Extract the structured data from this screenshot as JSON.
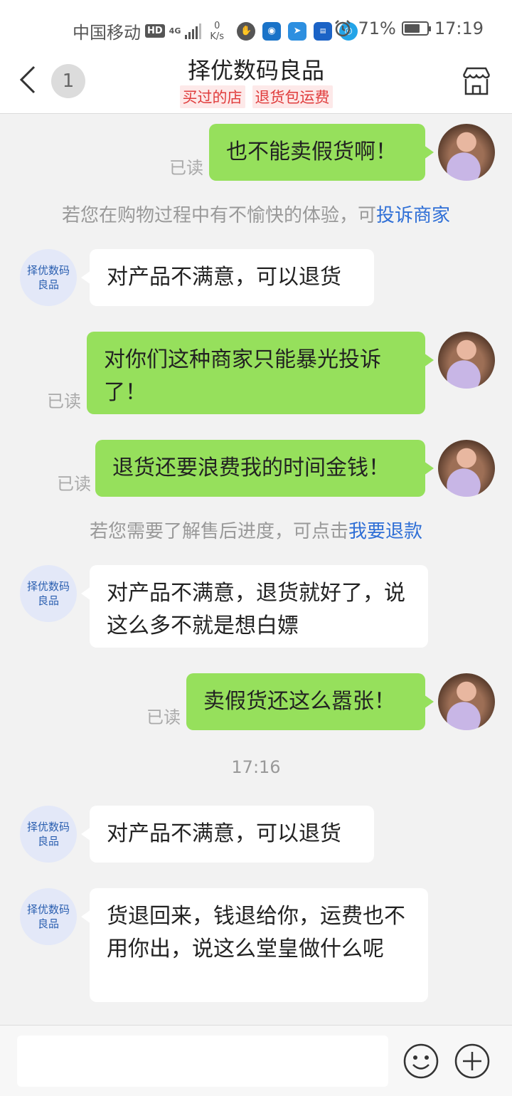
{
  "status_bar": {
    "carrier": "中国移动",
    "hd": "HD",
    "network": "4G",
    "speed_value": "0",
    "speed_unit": "K/s",
    "battery": "71%",
    "battery_level": 0.71,
    "time": "17:19"
  },
  "header": {
    "unread_count": "1",
    "title": "择优数码良品",
    "tags": [
      "买过的店",
      "退货包运费"
    ]
  },
  "shop_avatar_text": "择优数码\n良品",
  "read_label": "已读",
  "messages": [
    {
      "from": "me",
      "text": "也不能卖假货啊！",
      "read": "已读"
    },
    {
      "from": "system",
      "text": "若您在购物过程中有不愉快的体验，可",
      "link": "投诉商家"
    },
    {
      "from": "shop",
      "text": "对产品不满意，可以退货"
    },
    {
      "from": "me",
      "text": "对你们这种商家只能暴光投诉了！",
      "read": "已读"
    },
    {
      "from": "me",
      "text": "退货还要浪费我的时间金钱！",
      "read": "已读"
    },
    {
      "from": "system",
      "text": "若您需要了解售后进度，可点击",
      "link": "我要退款"
    },
    {
      "from": "shop",
      "text": "对产品不满意，退货就好了，说这么多不就是想白嫖"
    },
    {
      "from": "me",
      "text": "卖假货还这么嚣张！",
      "read": "已读"
    },
    {
      "from": "time",
      "text": "17:16"
    },
    {
      "from": "shop",
      "text": "对产品不满意，可以退货"
    },
    {
      "from": "shop",
      "text": "货退回来，钱退给你，运费也不用你出，说这么堂皇做什么呢"
    }
  ],
  "input": {
    "placeholder": ""
  },
  "colors": {
    "my_bubble": "#96e05c",
    "link": "#2f6fd6",
    "tag_text": "#e03c3c",
    "tag_bg": "#fde9e9"
  },
  "icons": [
    "back-arrow-icon",
    "shop-icon",
    "emoji-icon",
    "plus-icon",
    "alarm-icon"
  ]
}
